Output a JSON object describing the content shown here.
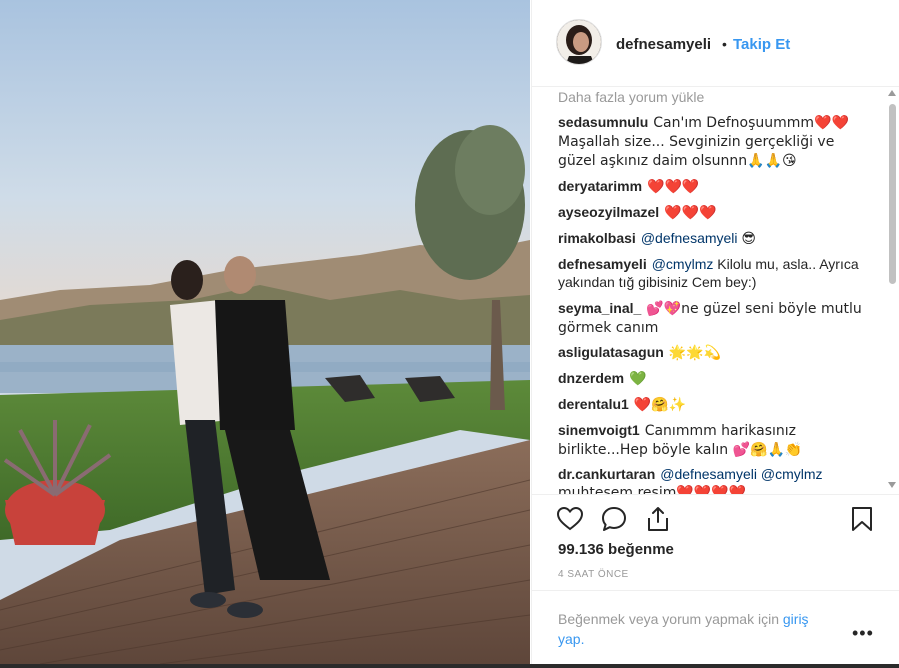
{
  "post": {
    "username": "defnesamyeli",
    "follow_separator": "•",
    "follow_label": "Takip Et",
    "load_more": "Daha fazla yorum yükle",
    "comments": [
      {
        "user": "sedasumnulu",
        "text": "Can'ım Defnoşuummm❤️❤️Maşallah size... Sevginizin gerçekliği ve güzel aşkınız daim olsunnn🙏🙏😘"
      },
      {
        "user": "deryatarimm",
        "text": "❤️❤️❤️"
      },
      {
        "user": "ayseozyilmazel",
        "text": "❤️❤️❤️"
      },
      {
        "user": "rimakolbasi",
        "mention": "@defnesamyeli",
        "text": "😎"
      },
      {
        "user": "defnesamyeli",
        "mention": "@cmylmz",
        "text": "Kilolu mu, asla.. Ayrıca yakından tığ gibisiniz Cem bey:)"
      },
      {
        "user": "seyma_inal_",
        "text": "💕💖ne güzel seni böyle mutlu görmek canım"
      },
      {
        "user": "asligulatasagun",
        "text": "🌟🌟💫"
      },
      {
        "user": "dnzerdem",
        "text": "💚"
      },
      {
        "user": "derentalu1",
        "text": "❤️🤗✨"
      },
      {
        "user": "sinemvoigt1",
        "text": "Canımmm harikasınız birlikte...Hep böyle kalın 💕🤗🙏👏"
      },
      {
        "user": "dr.cankurtaran",
        "mention": "@defnesamyeli @cmylmz",
        "text": "muhteşem resim❤️❤️❤️❤️"
      }
    ],
    "likes": "99.136 beğenme",
    "time": "4 SAAT ÖNCE",
    "login_text": "Beğenmek veya yorum yapmak için",
    "login_link": "giriş yap.",
    "more": "•••"
  },
  "icons": [
    "heart-icon",
    "comment-icon",
    "share-icon",
    "bookmark-icon",
    "more-options-icon"
  ]
}
